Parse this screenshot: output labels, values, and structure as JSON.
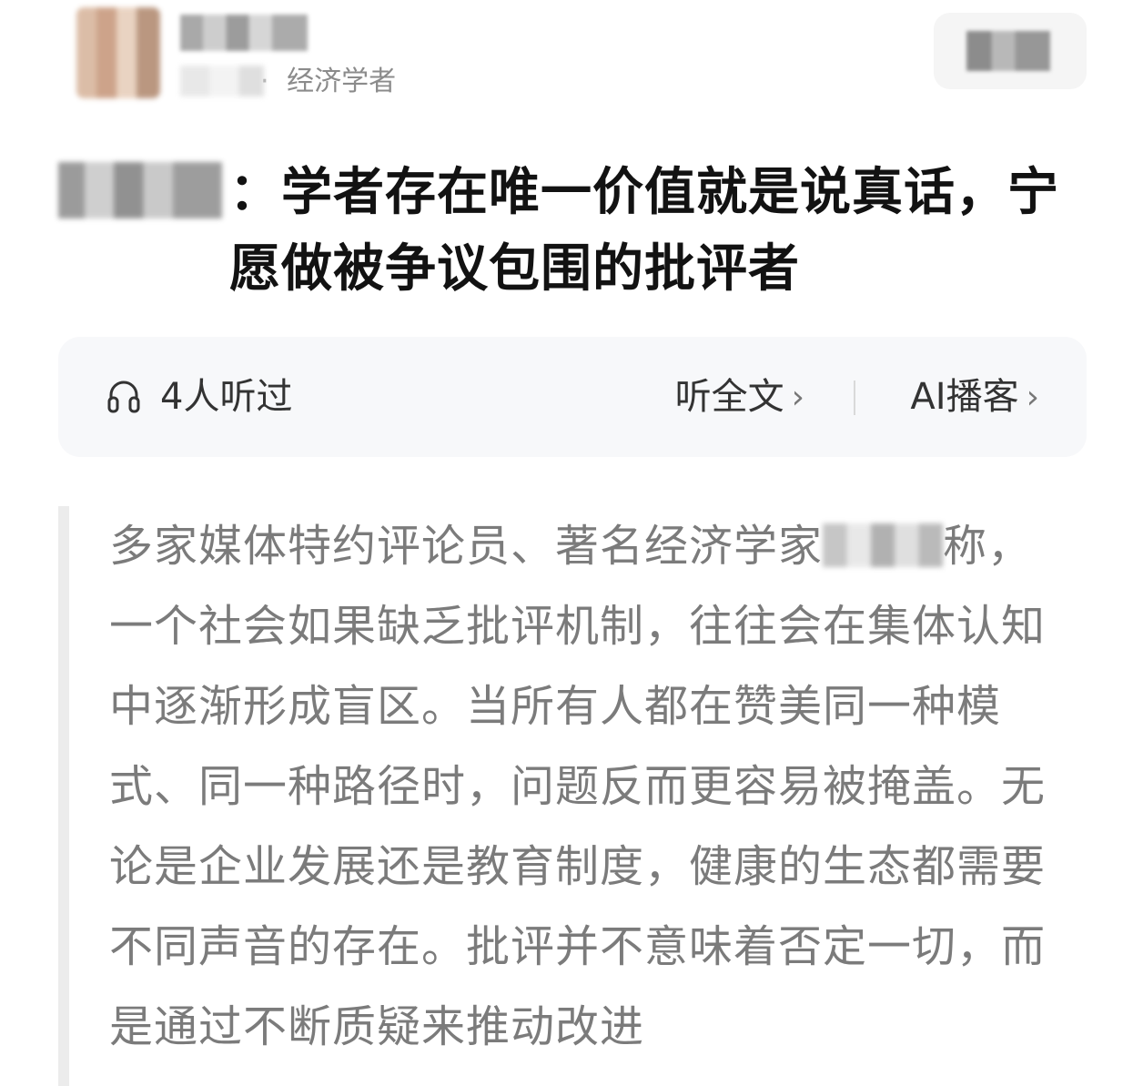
{
  "header": {
    "meta_text": "经济学者",
    "meta_separator": "·"
  },
  "article": {
    "title_text": "：学者存在唯一价值就是说真话，宁愿做被争议包围的批评者",
    "quote_part1": "多家媒体特约评论员、著名经济学家",
    "quote_part2": "称，一个社会如果缺乏批评机制，往往会在集体认知中逐渐形成盲区。当所有人都在赞美同一种模式、同一种路径时，问题反而更容易被掩盖。无论是企业发展还是教育制度，健康的生态都需要不同声音的存在。批评并不意味着否定一切，而是通过不断质疑来推动改进"
  },
  "audio_card": {
    "listen_count": "4人听过",
    "listen_full": "听全文",
    "ai_podcast": "AI播客",
    "chevron": "›"
  },
  "icons": {
    "headphone": "headphone-icon"
  },
  "colors": {
    "card_bg": "#f7f8fa",
    "quote_bar": "#ececec",
    "title_text": "#121212",
    "body_text": "#7b7b7b",
    "meta_text": "#8b8b8b"
  }
}
